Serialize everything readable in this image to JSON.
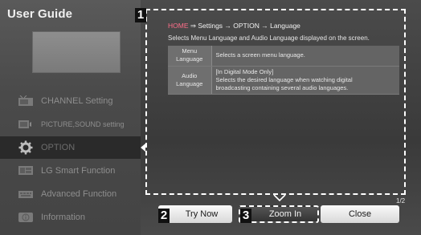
{
  "sidebar": {
    "title": "User Guide",
    "items": [
      {
        "label": "CHANNEL Setting",
        "icon": "tv-antenna-icon"
      },
      {
        "label": "PICTURE,SOUND setting",
        "icon": "picture-sound-icon"
      },
      {
        "label": "OPTION",
        "icon": "gear-icon"
      },
      {
        "label": "LG Smart Function",
        "icon": "smart-tv-icon"
      },
      {
        "label": "Advanced Function",
        "icon": "keyboard-icon"
      },
      {
        "label": "Information",
        "icon": "info-icon"
      }
    ],
    "active_index": 2
  },
  "steps": {
    "one": "1",
    "two": "2",
    "three": "3"
  },
  "content": {
    "path_home": "HOME",
    "path_rest": " ⇒ Settings → OPTION → Language",
    "description": "Selects Menu Language and Audio Language displayed on the screen.",
    "rows": [
      {
        "key_line1": "Menu",
        "key_line2": "Language",
        "value_line1": "Selects a screen menu language.",
        "value_line2": "",
        "value_line3": ""
      },
      {
        "key_line1": "Audio",
        "key_line2": "Language",
        "value_line1": "[In Digital Mode Only]",
        "value_line2": "Selects the desired language when watching digital",
        "value_line3": "broadcasting containing several audio languages."
      }
    ],
    "page_indicator": "1/2"
  },
  "buttons": {
    "try_now": "Try Now",
    "zoom_in": "Zoom In",
    "close": "Close"
  },
  "colors": {
    "home_accent": "#ff6e8a"
  }
}
